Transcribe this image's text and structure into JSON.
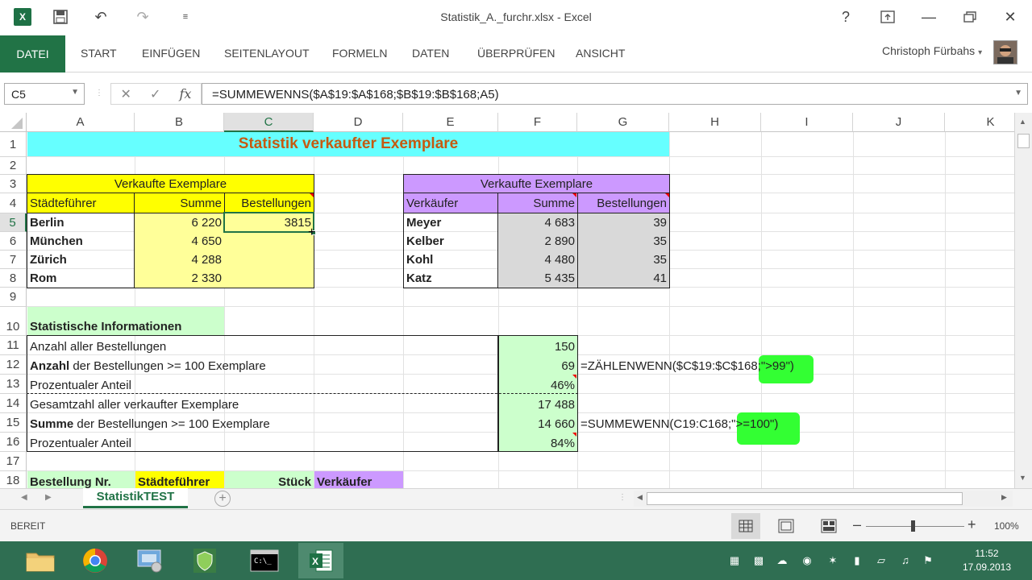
{
  "window": {
    "title": "Statistik_A._furchr.xlsx - Excel",
    "app_icon": "excel-icon",
    "quick_access": [
      "save-icon",
      "undo-icon",
      "redo-icon",
      "customize-icon"
    ],
    "controls": [
      "help-icon",
      "ribbon-display-icon",
      "minimize-icon",
      "restore-icon",
      "close-icon"
    ]
  },
  "ribbon": {
    "tabs": [
      "DATEI",
      "START",
      "EINFÜGEN",
      "SEITENLAYOUT",
      "FORMELN",
      "DATEN",
      "ÜBERPRÜFEN",
      "ANSICHT"
    ],
    "user": "Christoph Fürbahs"
  },
  "formula_bar": {
    "name_box": "C5",
    "formula": "=SUMMEWENNS($A$19:$A$168;$B$19:$B$168;A5)"
  },
  "grid": {
    "columns": [
      "A",
      "B",
      "C",
      "D",
      "E",
      "F",
      "G",
      "H",
      "I",
      "J",
      "K"
    ],
    "rows": [
      "1",
      "2",
      "3",
      "4",
      "5",
      "6",
      "7",
      "8",
      "9",
      "10",
      "11",
      "12",
      "13",
      "14",
      "15",
      "16",
      "17",
      "18"
    ],
    "selected_cell": "C5"
  },
  "cells": {
    "title": "Statistik verkaufter Exemplare",
    "t1": {
      "header": "Verkaufte Exemplare",
      "col_a": "Städteführer",
      "col_b": "Summe",
      "col_c": "Bestellungen",
      "rows": [
        {
          "name": "Berlin",
          "sum": "6 220",
          "orders": "3815"
        },
        {
          "name": "München",
          "sum": "4 650",
          "orders": ""
        },
        {
          "name": "Zürich",
          "sum": "4 288",
          "orders": ""
        },
        {
          "name": "Rom",
          "sum": "2 330",
          "orders": ""
        }
      ]
    },
    "t2": {
      "header": "Verkaufte Exemplare",
      "col_e": "Verkäufer",
      "col_f": "Summe",
      "col_g": "Bestellungen",
      "rows": [
        {
          "name": "Meyer",
          "sum": "4 683",
          "orders": "39"
        },
        {
          "name": "Kelber",
          "sum": "2 890",
          "orders": "35"
        },
        {
          "name": "Kohl",
          "sum": "4 480",
          "orders": "35"
        },
        {
          "name": "Katz",
          "sum": "5 435",
          "orders": "41"
        }
      ]
    },
    "stats": {
      "header": "Statistische Informationen",
      "r11": {
        "label": "Anzahl aller Bestellungen",
        "value": "150"
      },
      "r12": {
        "label_bold": "Anzahl",
        "label": " der Bestellungen >= 100 Exemplare",
        "value": "69",
        "note": "=ZÄHLENWENN($C$19:$C$168;\">99\")"
      },
      "r13": {
        "label": "Prozentualer Anteil",
        "value": "46%"
      },
      "r14": {
        "label": "Gesamtzahl aller verkaufter Exemplare",
        "value": "17 488"
      },
      "r15": {
        "label_bold": "Summe",
        "label": " der Bestellungen >= 100 Exemplare",
        "value": "14 660",
        "note": "=SUMMEWENN(C19:C168;\">=100\")"
      },
      "r16": {
        "label": "Prozentualer Anteil",
        "value": "84%"
      }
    },
    "r18": {
      "a": "Bestellung Nr.",
      "b": "Städteführer",
      "c": "Stück",
      "d": "Verkäufer"
    }
  },
  "sheet_tabs": {
    "active": "StatistikTEST"
  },
  "status": {
    "mode": "BEREIT",
    "zoom": "100%"
  },
  "taskbar": {
    "apps": [
      "file-explorer-icon",
      "chrome-icon",
      "control-panel-icon",
      "security-shield-icon",
      "command-prompt-icon",
      "excel-icon"
    ],
    "time": "11:52",
    "date": "17.09.2013"
  },
  "colors": {
    "excel_green": "#217346",
    "cyan": "#66ffff",
    "yellow": "#ffff00",
    "light_yellow": "#ffff99",
    "purple": "#cc99ff",
    "light_gray": "#d9d9d9",
    "light_green": "#ccffcc",
    "highlight_green": "#33ff33",
    "title_orange": "#c55a11"
  }
}
